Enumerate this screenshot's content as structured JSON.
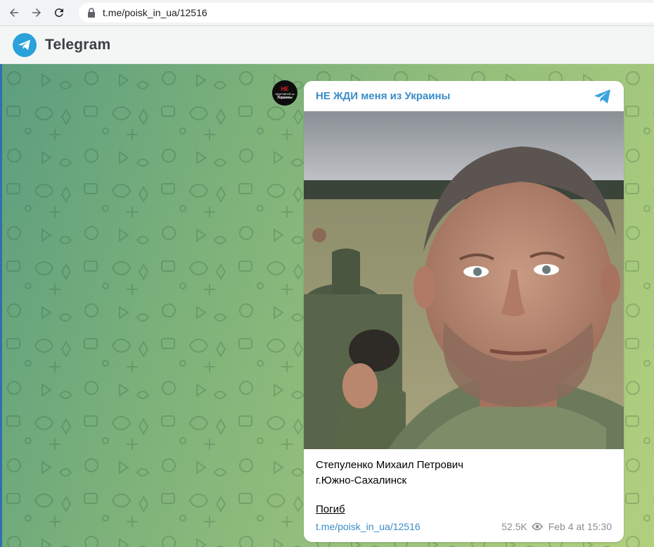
{
  "browser": {
    "url": "t.me/poisk_in_ua/12516"
  },
  "header": {
    "brand": "Telegram"
  },
  "channel": {
    "name": "НЕ ЖДИ меня из Украины",
    "avatar_line1": "НЕ",
    "avatar_line2": "ЖДИ МЕНЯ из",
    "avatar_line3": "Украины"
  },
  "message": {
    "line1": "Степуленко Михаил Петрович",
    "line2": "г.Южно-Сахалинск",
    "line3": "Погиб",
    "link": "t.me/poisk_in_ua/12516",
    "views": "52.5K",
    "date": "Feb 4 at 15:30"
  },
  "colors": {
    "accent": "#3a8dc9",
    "telegram_blue": "#2aa1da",
    "background_start": "#5c9e80",
    "background_end": "#b2cf7e"
  }
}
